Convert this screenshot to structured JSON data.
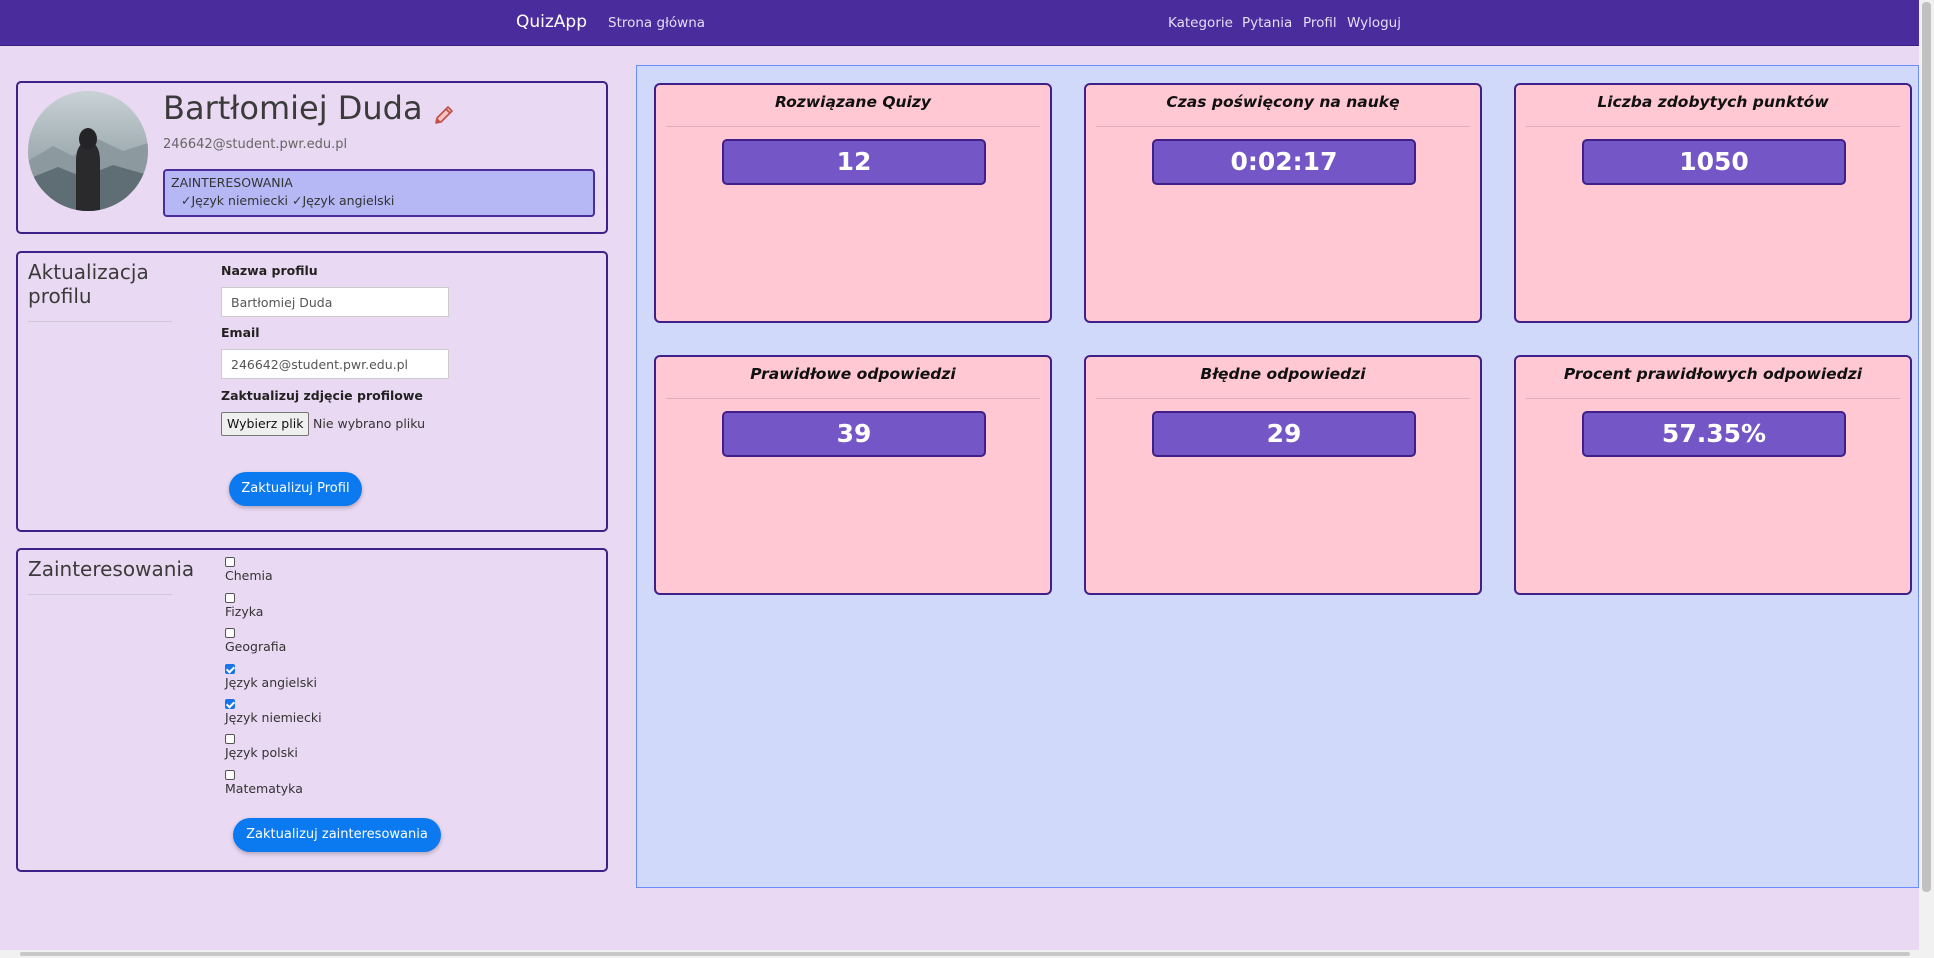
{
  "navbar": {
    "brand": "QuizApp",
    "home": "Strona główna",
    "categories": "Kategorie",
    "questions": "Pytania",
    "profile": "Profil",
    "logout": "Wyloguj"
  },
  "profile_card": {
    "name": "Bartłomiej Duda",
    "email": "246642@student.pwr.edu.pl",
    "interests_heading": "ZAINTERESOWANIA",
    "interests_list": "✓Język niemiecki ✓Język angielski",
    "edit_icon": "pencil-icon"
  },
  "update_profile": {
    "title": "Aktualizacja profilu",
    "name_label": "Nazwa profilu",
    "name_value": "Bartłomiej Duda",
    "email_label": "Email",
    "email_value": "246642@student.pwr.edu.pl",
    "photo_label": "Zaktualizuj zdjęcie profilowe",
    "file_button": "Wybierz plik",
    "file_status": "Nie wybrano pliku",
    "submit": "Zaktualizuj Profil"
  },
  "interests": {
    "title": "Zainteresowania",
    "items": [
      {
        "label": "Chemia",
        "checked": false
      },
      {
        "label": "Fizyka",
        "checked": false
      },
      {
        "label": "Geografia",
        "checked": false
      },
      {
        "label": "Język angielski",
        "checked": true
      },
      {
        "label": "Język niemiecki",
        "checked": true
      },
      {
        "label": "Język polski",
        "checked": false
      },
      {
        "label": "Matematyka",
        "checked": false
      }
    ],
    "submit": "Zaktualizuj zainteresowania"
  },
  "stats": [
    {
      "title": "Rozwiązane Quizy",
      "value": "12"
    },
    {
      "title": "Czas poświęcony na naukę",
      "value": "0:02:17"
    },
    {
      "title": "Liczba zdobytych punktów",
      "value": "1050"
    },
    {
      "title": "Prawidłowe odpowiedzi",
      "value": "39"
    },
    {
      "title": "Błędne odpowiedzi",
      "value": "29"
    },
    {
      "title": "Procent prawidłowych odpowiedzi",
      "value": "57.35%"
    }
  ],
  "colors": {
    "navbar": "#4b2c9c",
    "page_bg": "#ead9f3",
    "stat_card": "#ffc8d3",
    "stat_value": "#7456c6",
    "primary_button": "#0b79f0"
  }
}
